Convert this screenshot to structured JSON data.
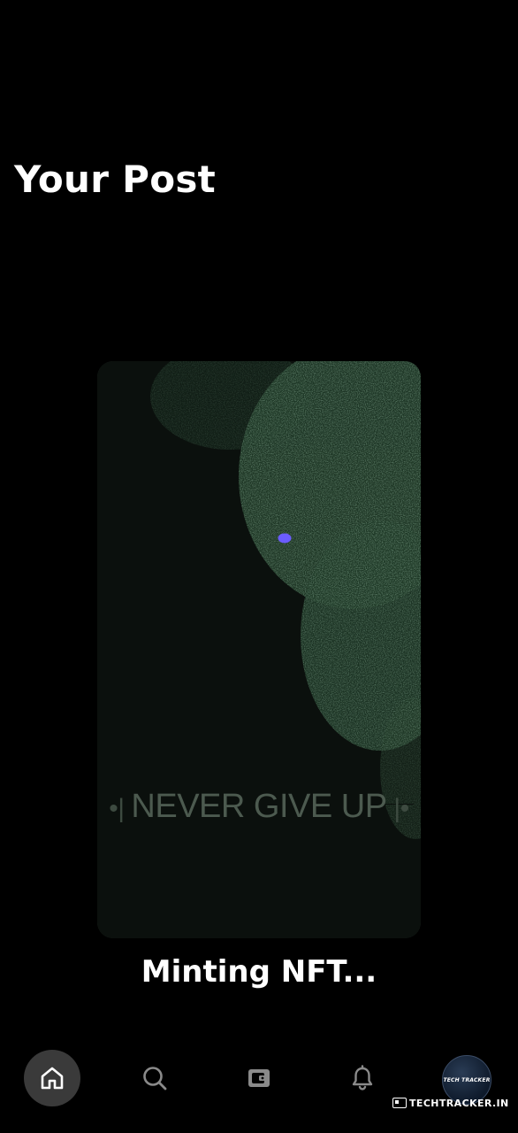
{
  "header": {
    "title": "Your Post"
  },
  "post": {
    "image_text": "NEVER GIVE UP",
    "image_icon": "nft-artwork"
  },
  "status": {
    "text": "Minting NFT..."
  },
  "nav": {
    "items": [
      {
        "icon": "home-icon",
        "active": true
      },
      {
        "icon": "search-icon",
        "active": false
      },
      {
        "icon": "wallet-icon",
        "active": false
      },
      {
        "icon": "bell-icon",
        "active": false
      },
      {
        "icon": "profile-avatar",
        "active": false
      }
    ],
    "avatar_text": "TECH TRACKER"
  },
  "watermark": {
    "text": "TECHTRACKER.IN"
  },
  "colors": {
    "background": "#000000",
    "active_nav": "#3a3a3a",
    "accent_dot": "#6b5cff",
    "foliage": "#3f6b4b"
  }
}
